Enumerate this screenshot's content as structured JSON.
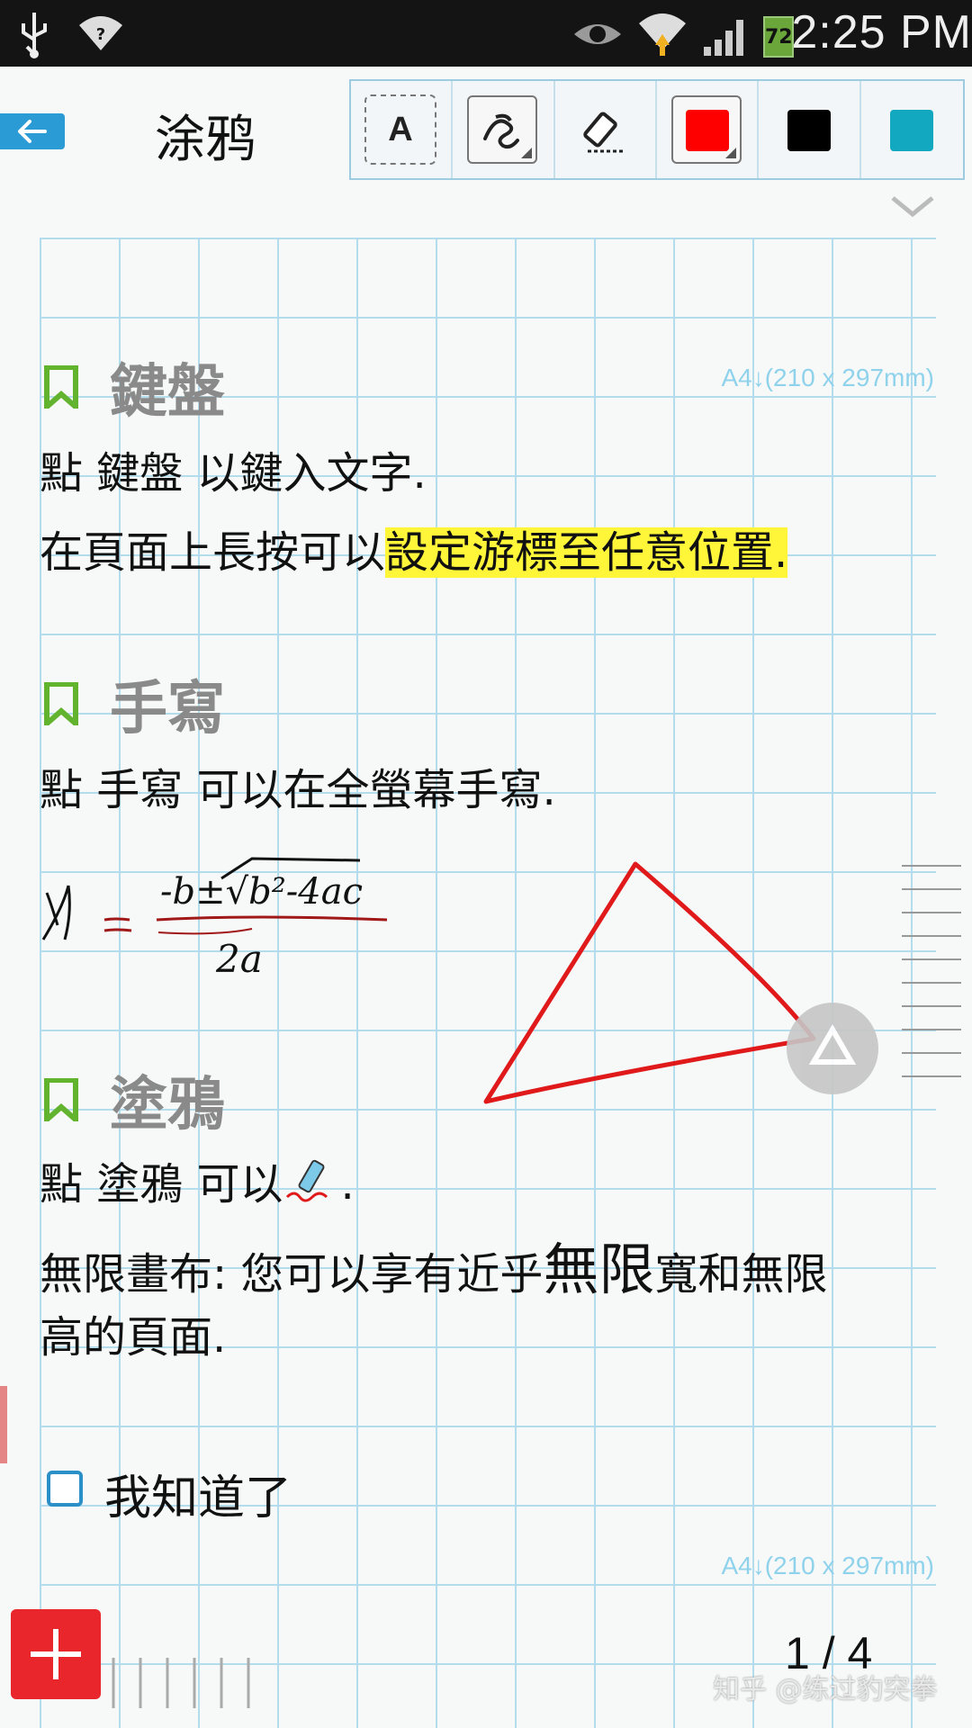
{
  "status_bar": {
    "time": "2:25 PM",
    "battery_level": "72",
    "icons": [
      "usb-icon",
      "wifi-question-icon",
      "eye-icon",
      "wifi-icon",
      "signal-icon",
      "battery-icon"
    ]
  },
  "toolbar": {
    "title": "涂鸦",
    "tools": [
      "text-tool-icon",
      "pen-tool-icon",
      "eraser-tool-icon",
      "color-red",
      "color-black",
      "color-teal"
    ],
    "colors": {
      "red": "#ff0000",
      "black": "#000000",
      "teal": "#12a9c0",
      "accent": "#2b9bd6"
    }
  },
  "sections": {
    "keyboard": {
      "title": "鍵盤",
      "line1": "點 鍵盤 以鍵入文字.",
      "line2_plain": "在頁面上長按可以",
      "line2_highlight": "設定游標至任意位置."
    },
    "handwriting": {
      "title": "手寫",
      "line1": "點 手寫 可以在全螢幕手寫."
    },
    "doodle": {
      "title": "塗鴉",
      "line1_a": "點 塗鴉 可以",
      "line1_b": ".",
      "line2_a": "無限畫布: 您可以享有近乎",
      "line2_big": "無限",
      "line2_b": "寬和無限",
      "line3": "高的頁面."
    }
  },
  "paper_size_label": "A4↓(210 x 297mm)",
  "checkbox_label": "我知道了",
  "page_counter": "1 / 4",
  "watermark": "知乎 @练过豹突拳"
}
